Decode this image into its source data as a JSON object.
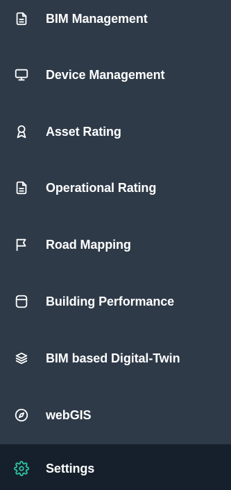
{
  "colors": {
    "background": "#2e3a48",
    "active_background": "#16202c",
    "text": "#ffffff",
    "active_icon": "#2ec4a6"
  },
  "sidebar": {
    "items": [
      {
        "label": "BIM Management",
        "icon": "document-icon",
        "active": false
      },
      {
        "label": "Device Management",
        "icon": "monitor-icon",
        "active": false
      },
      {
        "label": "Asset Rating",
        "icon": "award-icon",
        "active": false
      },
      {
        "label": "Operational Rating",
        "icon": "document-icon",
        "active": false
      },
      {
        "label": "Road Mapping",
        "icon": "flag-icon",
        "active": false
      },
      {
        "label": "Building Performance",
        "icon": "archive-icon",
        "active": false
      },
      {
        "label": "BIM based Digital-Twin",
        "icon": "layers-icon",
        "active": false
      },
      {
        "label": "webGIS",
        "icon": "compass-icon",
        "active": false
      },
      {
        "label": "Settings",
        "icon": "gear-icon",
        "active": true
      }
    ]
  }
}
